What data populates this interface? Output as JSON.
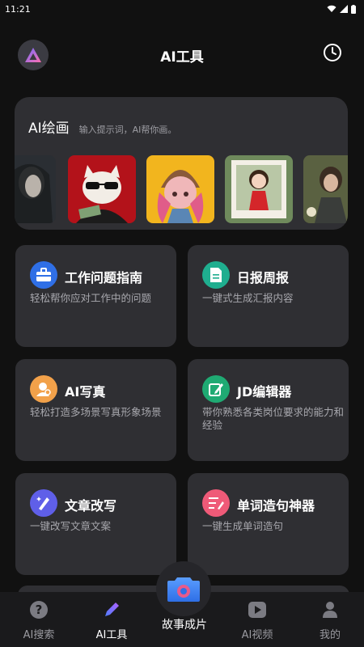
{
  "status": {
    "time": "11:21"
  },
  "header": {
    "title": "AI工具"
  },
  "ai_paint": {
    "title": "AI绘画",
    "subtitle": "输入提示词，AI帮你画。"
  },
  "cards": [
    {
      "title": "工作问题指南",
      "desc": "轻松帮你应对工作中的问题",
      "icon": "toolbox-icon",
      "color": "#2f6fe6"
    },
    {
      "title": "日报周报",
      "desc": "一键式生成汇报内容",
      "icon": "document-icon",
      "color": "#1fae8f"
    },
    {
      "title": "AI写真",
      "desc": "轻松打造多场景写真形象场景",
      "icon": "portrait-icon",
      "color": "#f2a14a"
    },
    {
      "title": "JD编辑器",
      "desc": "带你熟悉各类岗位要求的能力和经验",
      "icon": "edit-icon",
      "color": "#1faa73"
    },
    {
      "title": "文章改写",
      "desc": "一键改写文章文案",
      "icon": "rewrite-icon",
      "color": "#5f5fe8"
    },
    {
      "title": "单词造句神器",
      "desc": "一键生成单词造句",
      "icon": "sentence-icon",
      "color": "#ef5a78"
    }
  ],
  "nav": {
    "search": "AI搜索",
    "tools": "AI工具",
    "story": "故事成片",
    "video": "AI视频",
    "me": "我的"
  },
  "colors": {
    "background": "#111111",
    "card": "#2f2f33",
    "accent": "#3b82f6"
  }
}
